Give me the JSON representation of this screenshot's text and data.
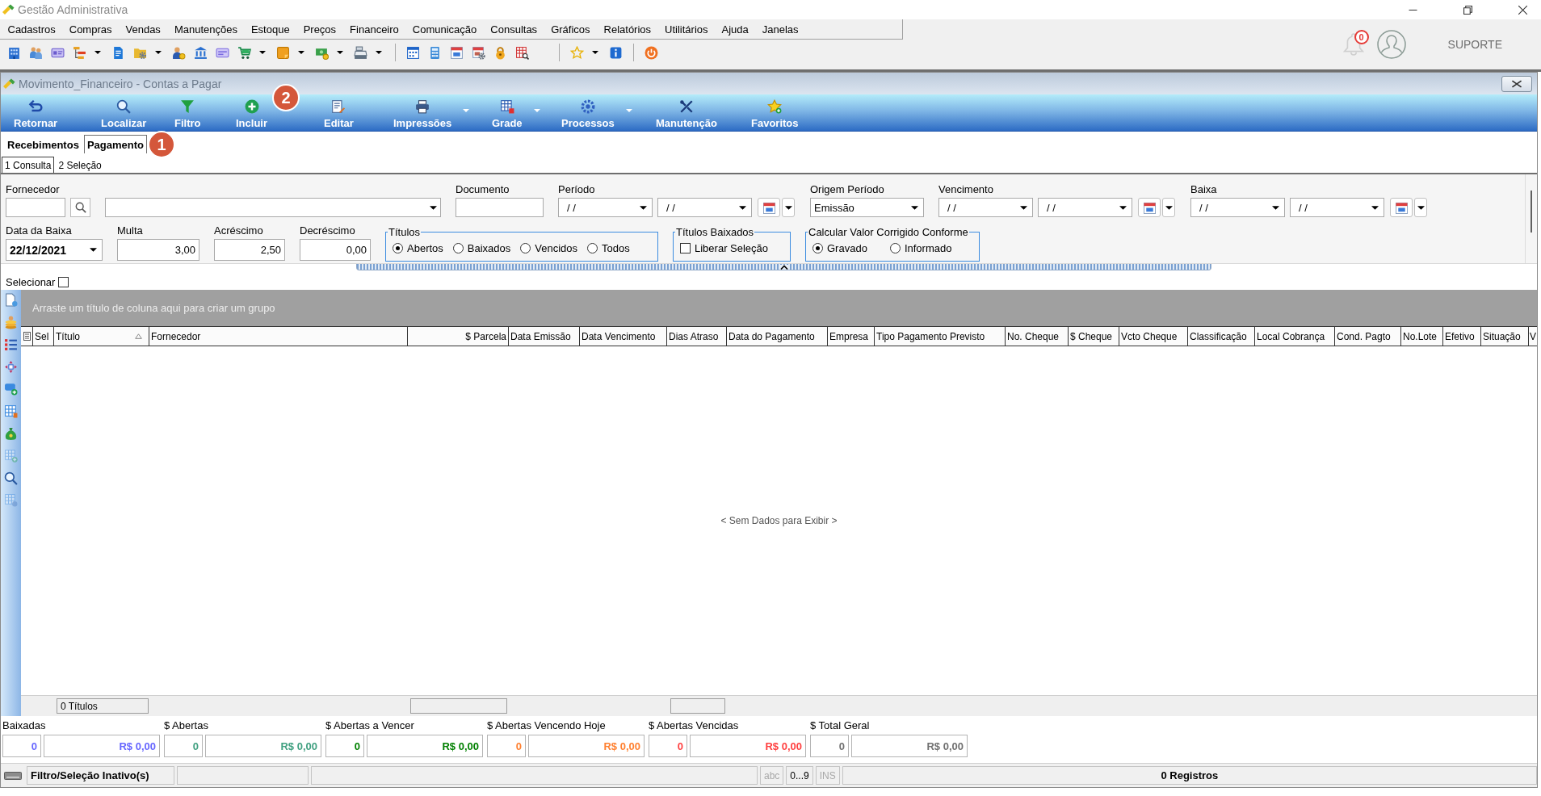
{
  "window": {
    "title": "Gestão Administrativa"
  },
  "menu": [
    "Cadastros",
    "Compras",
    "Vendas",
    "Manutenções",
    "Estoque",
    "Preços",
    "Financeiro",
    "Comunicação",
    "Consultas",
    "Gráficos",
    "Relatórios",
    "Utilitários",
    "Ajuda",
    "Janelas"
  ],
  "toolbar": {
    "groups": [
      {
        "items": [
          {
            "kind": "building",
            "dropdown": false
          },
          {
            "kind": "people",
            "dropdown": false
          },
          {
            "kind": "idcard",
            "dropdown": false
          },
          {
            "kind": "hierarchy",
            "dropdown": true
          },
          {
            "kind": "sheet",
            "dropdown": false
          },
          {
            "kind": "folder",
            "dropdown": true
          },
          {
            "kind": "person",
            "dropdown": false
          },
          {
            "kind": "bank",
            "dropdown": false
          },
          {
            "kind": "card",
            "dropdown": false
          },
          {
            "kind": "cart",
            "dropdown": true
          },
          {
            "kind": "note",
            "dropdown": true
          },
          {
            "kind": "money",
            "dropdown": true
          },
          {
            "kind": "register",
            "dropdown": true
          }
        ]
      },
      {
        "items": [
          {
            "kind": "calendargrid",
            "dropdown": false
          },
          {
            "kind": "calculator",
            "dropdown": false
          },
          {
            "kind": "calendar",
            "dropdown": false
          },
          {
            "kind": "calendargear",
            "dropdown": false
          },
          {
            "kind": "padlock",
            "dropdown": false
          },
          {
            "kind": "tablesearch",
            "dropdown": false
          }
        ]
      },
      {
        "items": [
          {
            "kind": "star",
            "dropdown": true
          },
          {
            "kind": "info",
            "dropdown": false
          }
        ]
      },
      {
        "items": [
          {
            "kind": "power",
            "dropdown": false
          }
        ]
      }
    ]
  },
  "notifications": {
    "count": "0"
  },
  "user": {
    "name": "SUPORTE"
  },
  "child_window": {
    "title": "Movimento_Financeiro - Contas a Pagar"
  },
  "ribbon": [
    {
      "label": "Retornar",
      "kind": "return",
      "dropdown": false
    },
    {
      "label": "Localizar",
      "kind": "search",
      "dropdown": false
    },
    {
      "label": "Filtro",
      "kind": "filter",
      "dropdown": false
    },
    {
      "label": "Incluir",
      "kind": "add",
      "dropdown": false,
      "callout": "2"
    },
    {
      "label": "Editar",
      "kind": "edit",
      "dropdown": false
    },
    {
      "label": "Impressões",
      "kind": "print",
      "dropdown": true
    },
    {
      "label": "Grade",
      "kind": "grid",
      "dropdown": true
    },
    {
      "label": "Processos",
      "kind": "gear",
      "dropdown": true
    },
    {
      "label": "Manutenção",
      "kind": "tools",
      "dropdown": false
    },
    {
      "label": "Favoritos",
      "kind": "favorite",
      "dropdown": false
    }
  ],
  "tabs": [
    {
      "label": "Recebimentos",
      "selected": false
    },
    {
      "label": "Pagamento",
      "selected": true,
      "callout": "1"
    }
  ],
  "subtabs": [
    {
      "label": "1 Consulta",
      "selected": true
    },
    {
      "label": "2 Seleção",
      "selected": false
    }
  ],
  "filters": {
    "row1": [
      {
        "kind": "supplier",
        "label": "Fornecedor"
      },
      {
        "kind": "text",
        "label": "Documento"
      },
      {
        "kind": "daterange",
        "label": "Período",
        "from": "/ /",
        "to": "/ /"
      },
      {
        "kind": "select",
        "label": "Origem Período",
        "value": "Emissão"
      },
      {
        "kind": "daterange",
        "label": "Vencimento",
        "from": "/ /",
        "to": "/ /"
      },
      {
        "kind": "daterange",
        "label": "Baixa",
        "from": "/ /",
        "to": "/ /"
      }
    ],
    "row2": [
      {
        "kind": "date",
        "label": "Data da Baixa",
        "value": "22/12/2021"
      },
      {
        "kind": "number",
        "label": "Multa",
        "value": "3,00"
      },
      {
        "kind": "number",
        "label": "Acréscimo",
        "value": "2,50"
      },
      {
        "kind": "number",
        "label": "Decréscimo",
        "value": "0,00"
      },
      {
        "kind": "radios",
        "label": "Títulos",
        "options": [
          {
            "label": "Abertos",
            "selected": true
          },
          {
            "label": "Baixados",
            "selected": false
          },
          {
            "label": "Vencidos",
            "selected": false
          },
          {
            "label": "Todos",
            "selected": false
          }
        ]
      },
      {
        "kind": "checks",
        "label": "Títulos Baixados",
        "options": [
          {
            "label": "Liberar Seleção",
            "checked": false
          }
        ]
      },
      {
        "kind": "radios",
        "label": "Calcular Valor Corrigido Conforme",
        "options": [
          {
            "label": "Gravado",
            "selected": true
          },
          {
            "label": "Informado",
            "selected": false
          }
        ]
      }
    ]
  },
  "select_all": {
    "label": "Selecionar",
    "checked": false
  },
  "side_tools": [
    {
      "kind": "document",
      "disabled": false
    },
    {
      "kind": "coins",
      "disabled": false
    },
    {
      "kind": "list",
      "disabled": false
    },
    {
      "kind": "move",
      "disabled": false
    },
    {
      "kind": "comment",
      "disabled": false
    },
    {
      "kind": "gridedit",
      "disabled": false
    },
    {
      "kind": "moneybag",
      "disabled": false
    },
    {
      "kind": "gridadd",
      "disabled": true
    },
    {
      "kind": "search",
      "disabled": false
    },
    {
      "kind": "gridgear",
      "disabled": true
    }
  ],
  "grid": {
    "group_hint": "Arraste um título de coluna aqui para criar um grupo",
    "columns": [
      {
        "label": "Sel",
        "sorted": false
      },
      {
        "label": "Título",
        "sorted": true
      },
      {
        "label": "Fornecedor",
        "sorted": false
      },
      {
        "label": "$ Parcela",
        "sorted": false
      },
      {
        "label": "Data Emissão",
        "sorted": false
      },
      {
        "label": "Data Vencimento",
        "sorted": false
      },
      {
        "label": "Dias Atraso",
        "sorted": false
      },
      {
        "label": "Data do Pagamento",
        "sorted": false
      },
      {
        "label": "Empresa",
        "sorted": false
      },
      {
        "label": "Tipo Pagamento Previsto",
        "sorted": false
      },
      {
        "label": "No. Cheque",
        "sorted": false
      },
      {
        "label": "$ Cheque",
        "sorted": false
      },
      {
        "label": "Vcto Cheque",
        "sorted": false
      },
      {
        "label": "Classificação",
        "sorted": false
      },
      {
        "label": "Local Cobrança",
        "sorted": false
      },
      {
        "label": "Cond. Pagto",
        "sorted": false
      },
      {
        "label": "No.Lote",
        "sorted": false
      },
      {
        "label": "Efetivo",
        "sorted": false
      },
      {
        "label": "Situação",
        "sorted": false
      },
      {
        "label": "V",
        "sorted": false
      }
    ],
    "empty_text": "< Sem Dados para Exibir >",
    "footer": {
      "count": "0 Títulos"
    }
  },
  "totals": [
    {
      "label": "Baixadas",
      "count": "0",
      "amount": "R$ 0,00",
      "color": "#6666ff"
    },
    {
      "label": "$ Abertas",
      "count": "0",
      "amount": "R$ 0,00",
      "color": "#40a080"
    },
    {
      "label": "$ Abertas a Vencer",
      "count": "0",
      "amount": "R$ 0,00",
      "color": "#008000"
    },
    {
      "label": "$ Abertas Vencendo Hoje",
      "count": "0",
      "amount": "R$ 0,00",
      "color": "#ff8030"
    },
    {
      "label": "$ Abertas Vencidas",
      "count": "0",
      "amount": "R$ 0,00",
      "color": "#ff4040"
    },
    {
      "label": "$ Total Geral",
      "count": "0",
      "amount": "R$ 0,00",
      "color": "#707070"
    }
  ],
  "status_bar": {
    "filter": "Filtro/Seleção Inativo(s)",
    "indicators": [
      {
        "text": "abc",
        "on": false
      },
      {
        "text": "0...9",
        "on": true
      },
      {
        "text": "INS",
        "on": false
      }
    ],
    "records": "0 Registros"
  }
}
